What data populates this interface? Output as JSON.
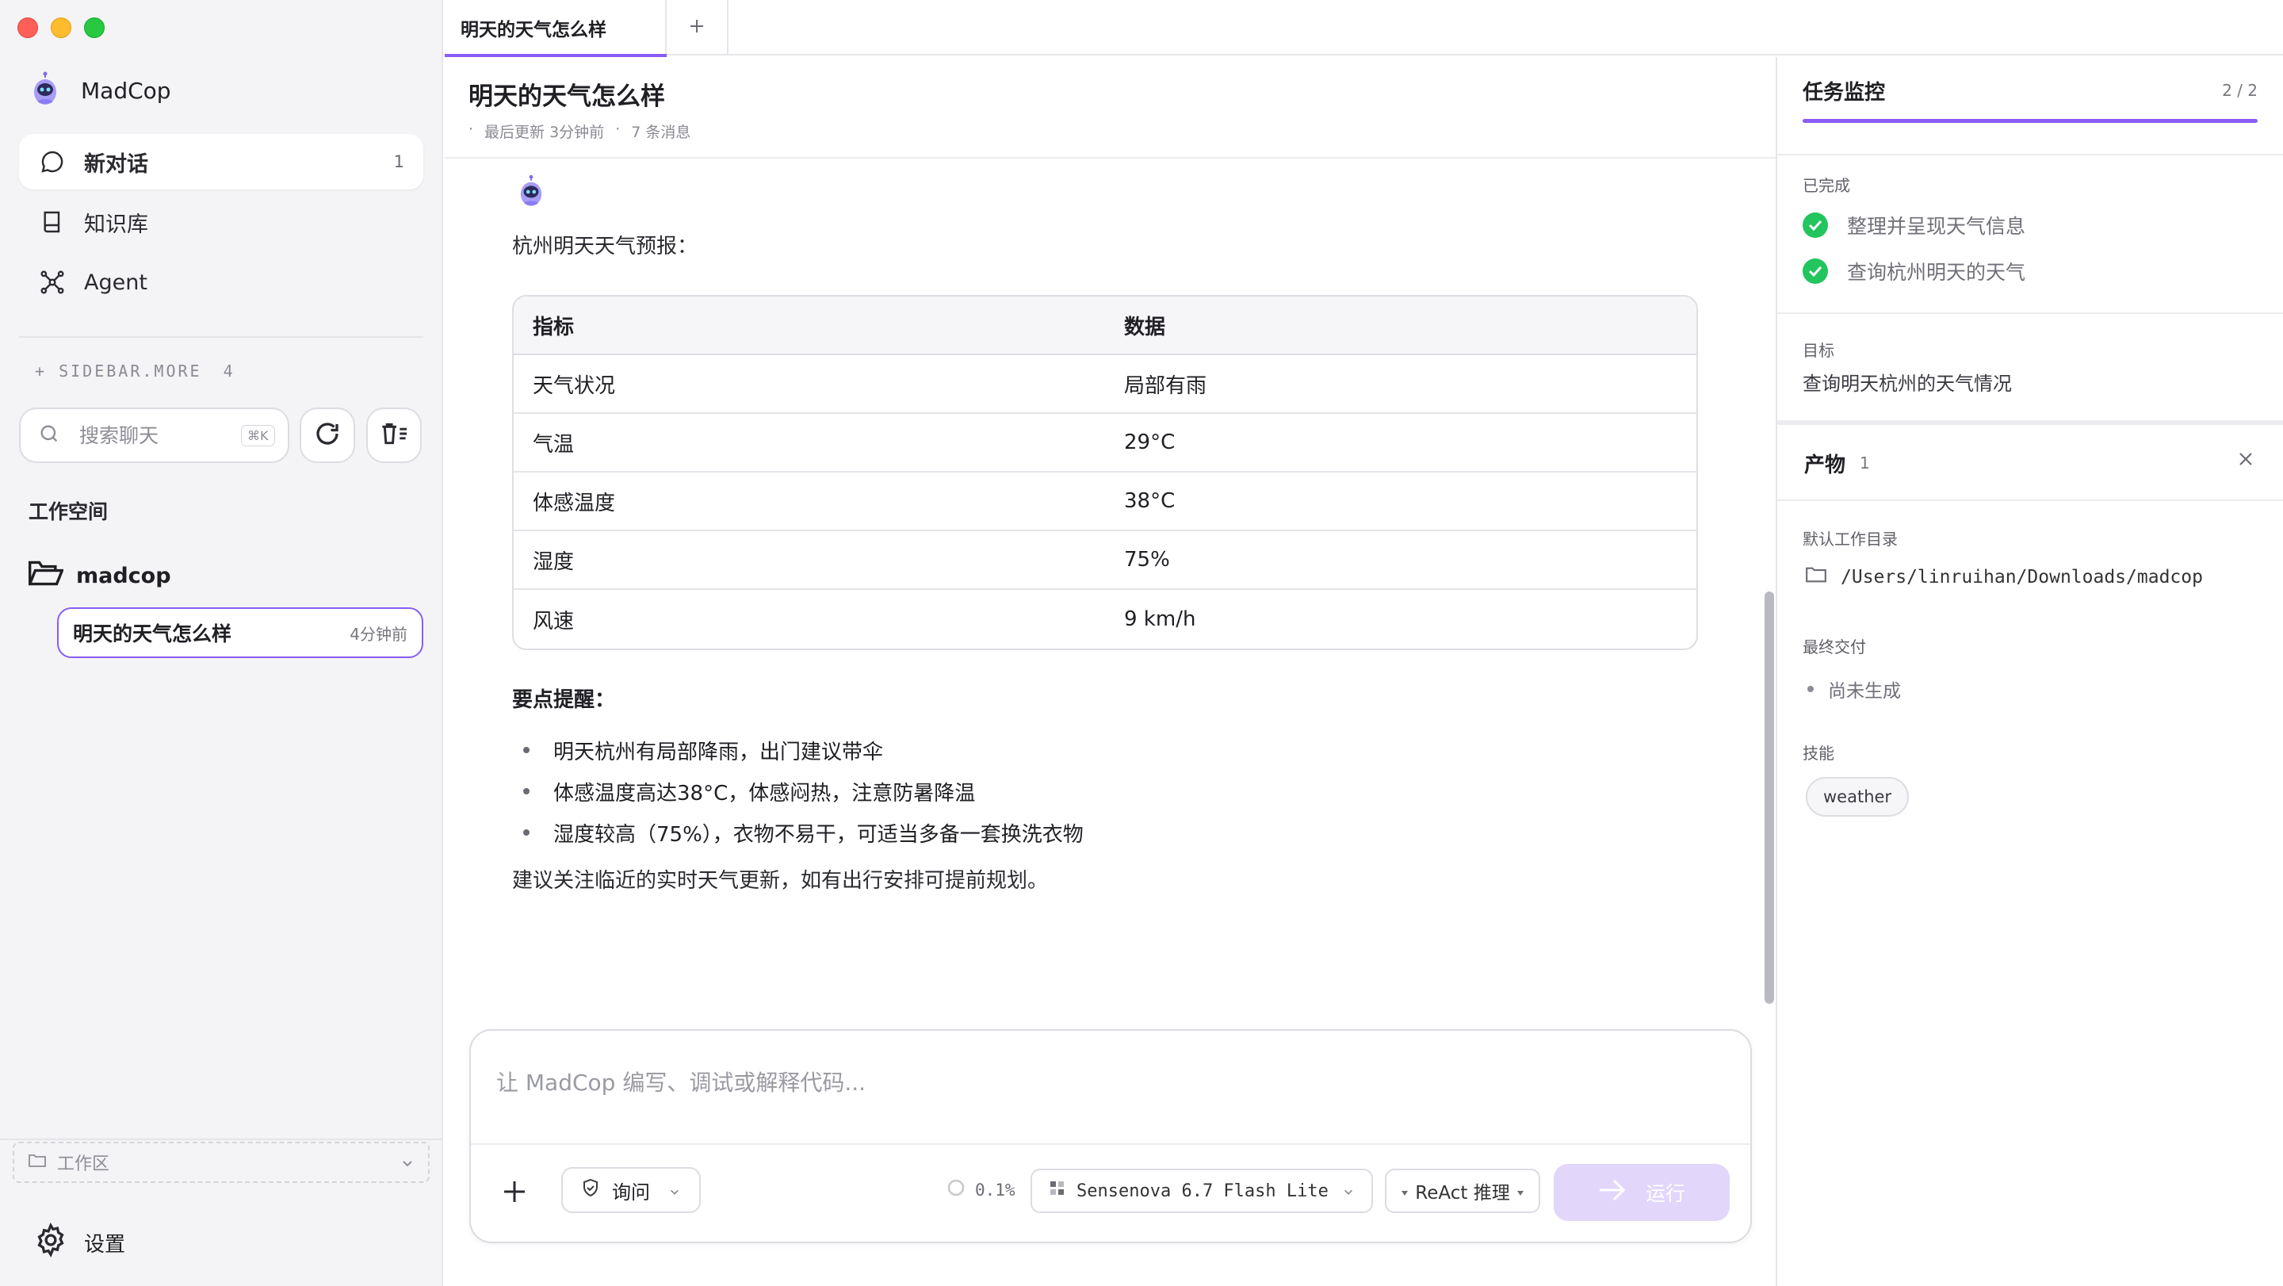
{
  "sidebar": {
    "brand": "MadCop",
    "nav": [
      {
        "label": "新对话",
        "count": "1"
      },
      {
        "label": "知识库"
      },
      {
        "label": "Agent"
      }
    ],
    "more_label": "+ SIDEBAR.MORE",
    "more_count": "4",
    "search_placeholder": "搜索聊天",
    "search_shortcut": "⌘K",
    "workspace_label": "工作空间",
    "folder_name": "madcop",
    "chat_item": {
      "title": "明天的天气怎么样",
      "time": "4分钟前"
    },
    "workspace_select": "工作区",
    "settings": "设置"
  },
  "tabs": [
    {
      "label": "明天的天气怎么样"
    }
  ],
  "header": {
    "title": "明天的天气怎么样",
    "updated": "最后更新 3分钟前",
    "messages": "7 条消息"
  },
  "message": {
    "intro": "杭州明天天气预报：",
    "table": {
      "headers": [
        "指标",
        "数据"
      ],
      "rows": [
        [
          "天气状况",
          "局部有雨"
        ],
        [
          "气温",
          "29°C"
        ],
        [
          "体感温度",
          "38°C"
        ],
        [
          "湿度",
          "75%"
        ],
        [
          "风速",
          "9 km/h"
        ]
      ]
    },
    "tips_title": "要点提醒：",
    "tips": [
      "明天杭州有局部降雨，出门建议带伞",
      "体感温度高达38°C，体感闷热，注意防暑降温",
      "湿度较高（75%），衣物不易干，可适当多备一套换洗衣物"
    ],
    "closing": "建议关注临近的实时天气更新，如有出行安排可提前规划。"
  },
  "composer": {
    "placeholder": "让 MadCop 编写、调试或解释代码...",
    "mode_label": "询问",
    "context_usage": "0.1%",
    "model": "Sensenova 6.7 Flash Lite",
    "reasoning": "ReAct 推理",
    "run_label": "运行"
  },
  "task_monitor": {
    "title": "任务监控",
    "progress": "2 / 2",
    "completed_label": "已完成",
    "tasks": [
      "整理并呈现天气信息",
      "查询杭州明天的天气"
    ],
    "goal_label": "目标",
    "goal": "查询明天杭州的天气情况"
  },
  "artifacts": {
    "title": "产物",
    "count": "1",
    "workdir_label": "默认工作目录",
    "workdir": "/Users/linruihan/Downloads/madcop",
    "delivery_label": "最终交付",
    "delivery_status": "尚未生成",
    "skills_label": "技能",
    "skills": [
      "weather"
    ]
  },
  "colors": {
    "accent": "#8a5cf6",
    "accent_dark": "#7c3aed",
    "success": "#22c55e",
    "run_disabled": "#e2d6fb"
  }
}
